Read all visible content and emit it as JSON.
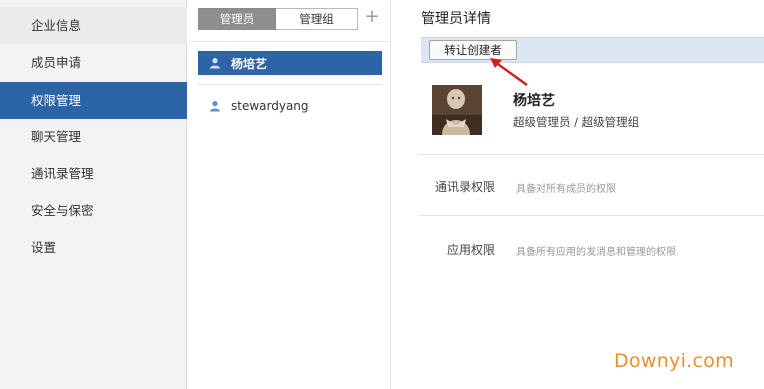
{
  "sidebar": {
    "items": [
      {
        "label": "企业信息"
      },
      {
        "label": "成员申请"
      },
      {
        "label": "权限管理"
      },
      {
        "label": "聊天管理"
      },
      {
        "label": "通讯录管理"
      },
      {
        "label": "安全与保密"
      },
      {
        "label": "设置"
      }
    ],
    "active_index": 2
  },
  "middle": {
    "tabs": [
      {
        "label": "管理员",
        "active": true
      },
      {
        "label": "管理组",
        "active": false
      }
    ],
    "add_label": "+",
    "members": [
      {
        "name": "杨培艺",
        "selected": true,
        "icon": "user-icon"
      },
      {
        "name": "stewardyang",
        "selected": false,
        "icon": "user-icon"
      }
    ]
  },
  "detail": {
    "title": "管理员详情",
    "transfer_button": "转让创建者",
    "name": "杨培艺",
    "role": "超级管理员 / 超级管理组",
    "permissions": [
      {
        "label": "通讯录权限",
        "value": "具备对所有成员的权限"
      },
      {
        "label": "应用权限",
        "value": "具备所有应用的发消息和管理的权限"
      }
    ]
  },
  "watermark": "Downyi.com",
  "colors": {
    "accent": "#2c64a8",
    "toolbar_bg": "#dce6f2",
    "sidebar_bg": "#f3f3f3",
    "arrow": "#d11f1f",
    "watermark": "#e8912c"
  }
}
